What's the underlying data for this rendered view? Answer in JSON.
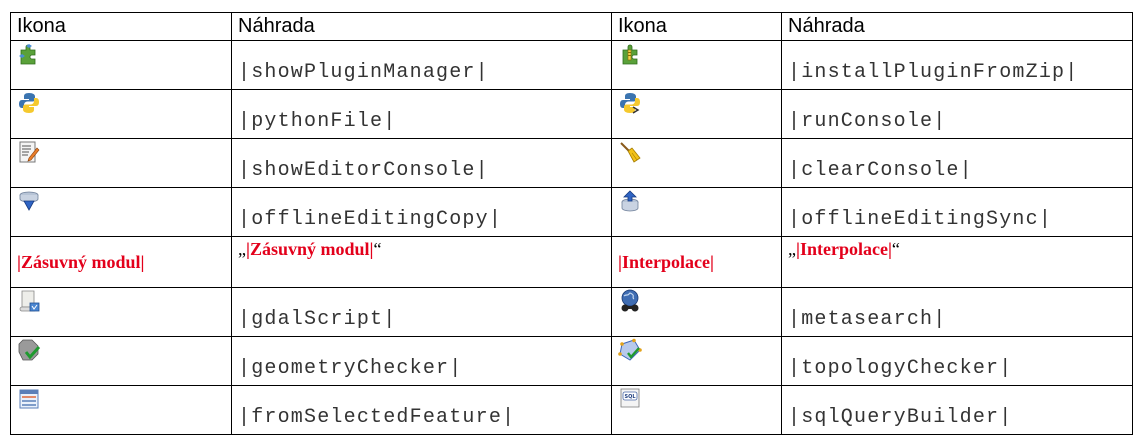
{
  "headers": [
    "Ikona",
    "Náhrada",
    "Ikona",
    "Náhrada"
  ],
  "rows": [
    {
      "left_icon": "plugin-manager-icon",
      "left_text": "|showPluginManager|",
      "right_icon": "install-plugin-zip-icon",
      "right_text": "|installPluginFromZip|"
    },
    {
      "left_icon": "python-file-icon",
      "left_text": "|pythonFile|",
      "right_icon": "run-console-icon",
      "right_text": "|runConsole|"
    },
    {
      "left_icon": "editor-console-icon",
      "left_text": "|showEditorConsole|",
      "right_icon": "clear-console-icon",
      "right_text": "|clearConsole|"
    },
    {
      "left_icon": "offline-editing-copy-icon",
      "left_text": "|offlineEditingCopy|",
      "right_icon": "offline-editing-sync-icon",
      "right_text": "|offlineEditingSync|"
    }
  ],
  "special_row": {
    "left_label": "|Zásuvný modul|",
    "left_quote_open": "„",
    "left_quote_text": "|Zásuvný modul|",
    "left_quote_close": "“",
    "right_label": "|Interpolace|",
    "right_quote_open": "„",
    "right_quote_text": "|Interpolace|",
    "right_quote_close": "“"
  },
  "rows2": [
    {
      "left_icon": "gdal-script-icon",
      "left_text": "|gdalScript|",
      "right_icon": "metasearch-icon",
      "right_text": "|metasearch|"
    },
    {
      "left_icon": "geometry-checker-icon",
      "left_text": "|geometryChecker|",
      "right_icon": "topology-checker-icon",
      "right_text": "|topologyChecker|"
    },
    {
      "left_icon": "from-selected-feature-icon",
      "left_text": "|fromSelectedFeature|",
      "right_icon": "sql-query-builder-icon",
      "right_text": "|sqlQueryBuilder|"
    }
  ],
  "colors": {
    "red_label": "#e3001b"
  }
}
